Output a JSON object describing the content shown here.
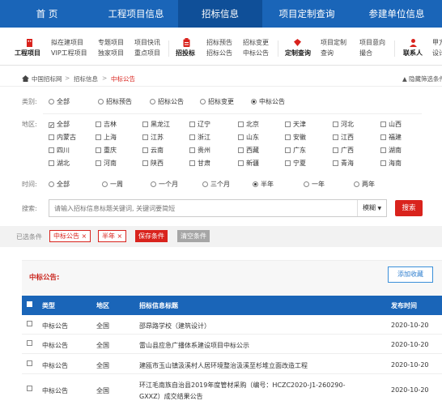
{
  "topnav": [
    "首 页",
    "工程项目信息",
    "招标信息",
    "项目定制查询",
    "参建单位信息"
  ],
  "iconbar": {
    "g1": {
      "l1": "工程项目"
    },
    "g2": {
      "l1": "拟在建项目",
      "l2": "VIP工程项目"
    },
    "g3": {
      "l1": "专题项目",
      "l2": "独家项目"
    },
    "g4": {
      "l1": "项目快讯",
      "l2": "重点项目"
    },
    "g5": {
      "l1": "招投标"
    },
    "g6": {
      "l1": "招标预告",
      "l2": "招标公告"
    },
    "g7": {
      "l1": "招标变更",
      "l2": "中标公告"
    },
    "g8": {
      "l1": "定制查询"
    },
    "g9": {
      "l1": "项目定制",
      "l2": "查询"
    },
    "g10": {
      "l1": "项目意向",
      "l2": "撮合"
    },
    "g11": {
      "l1": "联系人"
    },
    "g12": {
      "l1": "甲方",
      "l2": "设计"
    }
  },
  "breadcrumb": {
    "home": "中国招标网",
    "sep1": ">",
    "mid": "招标信息",
    "sep2": ">",
    "current": "中标公告",
    "right": "隐藏筛选条件"
  },
  "filters": {
    "category_label": "类别:",
    "category": [
      "全部",
      "招标预告",
      "招标公告",
      "招标变更",
      "中标公告"
    ],
    "region_label": "地区:",
    "regions": [
      [
        "全部",
        "吉林",
        "黑龙江",
        "辽宁",
        "北京",
        "天津",
        "河北",
        "山西"
      ],
      [
        "内蒙古",
        "上海",
        "江苏",
        "浙江",
        "山东",
        "安徽",
        "江西",
        "福建"
      ],
      [
        "四川",
        "重庆",
        "云南",
        "贵州",
        "西藏",
        "广东",
        "广西",
        "湖南"
      ],
      [
        "湖北",
        "河南",
        "陕西",
        "甘肃",
        "新疆",
        "宁夏",
        "青海",
        "海南"
      ]
    ],
    "time_label": "时间:",
    "time": [
      "全部",
      "一周",
      "一个月",
      "三个月",
      "半年",
      "一年",
      "两年"
    ],
    "search_label": "搜索:",
    "search_placeholder": "请输入招标信息标题关键词, 关键词要简短",
    "search_mode": "模糊",
    "search_button": "搜索"
  },
  "conditions": {
    "label": "已选条件",
    "tag1": "中标公告 ×",
    "tag2": "半年 ×",
    "save": "保存条件",
    "clear": "清空条件"
  },
  "panel": {
    "title": "中标公告:",
    "fav": "添加收藏"
  },
  "table": {
    "headers": [
      "类型",
      "地区",
      "招标信息标题",
      "发布时间"
    ],
    "rows": [
      {
        "type": "中标公告",
        "region": "全国",
        "title": "邵昂路学校（建筑设计）",
        "date": "2020-10-20"
      },
      {
        "type": "中标公告",
        "region": "全国",
        "title": "雷山县应急广播体系建设项目中标公示",
        "date": "2020-10-20"
      },
      {
        "type": "中标公告",
        "region": "全国",
        "title": "建瓯市玉山镇汲溪村人居环境整治汲溪至杉堆立面改造工程",
        "date": "2020-10-20"
      },
      {
        "type": "中标公告",
        "region": "全国",
        "title": "环江毛南族自治县2019年度管材采购（编号：HCZC2020-J1-260290-",
        "title2": "GXXZ）成交结果公告",
        "date": "2020-10-20"
      }
    ]
  }
}
